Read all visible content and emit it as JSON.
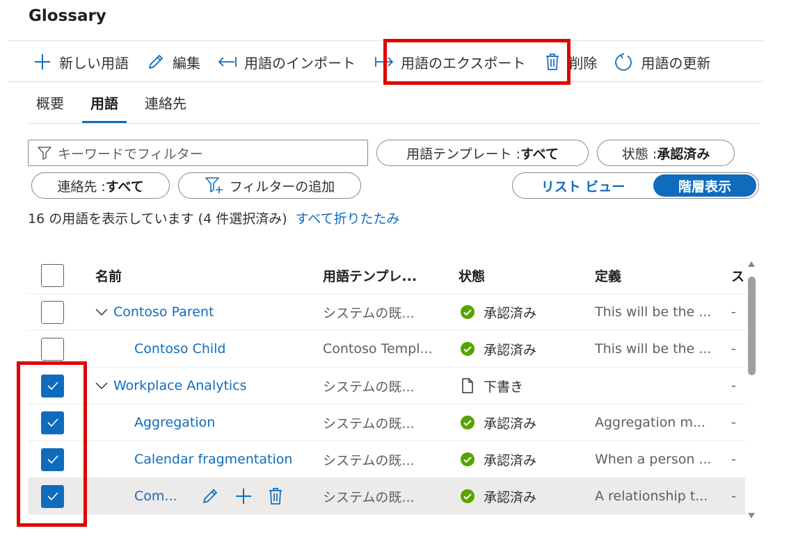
{
  "page": {
    "title": "Glossary"
  },
  "toolbar": {
    "new_term": "新しい用語",
    "edit": "編集",
    "import": "用語のインポート",
    "export": "用語のエクスポート",
    "delete": "削除",
    "refresh": "用語の更新"
  },
  "tabs": [
    "概要",
    "用語",
    "連絡先"
  ],
  "active_tab": "用語",
  "filters": {
    "search_placeholder": "キーワードでフィルター",
    "template_label": "用語テンプレート : ",
    "template_value": "すべて",
    "status_label": "状態 : ",
    "status_value": "承認済み",
    "contact_label": "連絡先 : ",
    "contact_value": "すべて",
    "add_filter": "フィルターの追加"
  },
  "view_toggle": {
    "list": "リスト ビュー",
    "hierarchy": "階層表示",
    "selected": "階層表示"
  },
  "summary": {
    "text": "16 の用語を表示しています (4 件選択済み)",
    "collapse_all": "すべて折りたたみ"
  },
  "table": {
    "columns": [
      "名前",
      "用語テンプレ...",
      "状態",
      "定義",
      "ス"
    ],
    "rows": [
      {
        "name": "Contoso Parent",
        "template": "システムの既...",
        "status": "承認済み",
        "definition": "This will be the ...",
        "extra": "-",
        "checked": false
      },
      {
        "name": "Contoso Child",
        "template": "Contoso Templ...",
        "status": "承認済み",
        "definition": "This will be the ...",
        "extra": "-",
        "checked": false
      },
      {
        "name": "Workplace Analytics",
        "template": "システムの既...",
        "status": "下書き",
        "definition": "",
        "extra": "-",
        "checked": true
      },
      {
        "name": "Aggregation",
        "template": "システムの既...",
        "status": "承認済み",
        "definition": "Aggregation m...",
        "extra": "-",
        "checked": true
      },
      {
        "name": "Calendar fragmentation",
        "template": "システムの既...",
        "status": "承認済み",
        "definition": "When a person ...",
        "extra": "-",
        "checked": true
      },
      {
        "name": "Com...",
        "template": "システムの既...",
        "status": "承認済み",
        "definition": "A relationship t...",
        "extra": "-",
        "checked": true
      }
    ]
  },
  "colors": {
    "accent": "#0f6cbd",
    "approved": "#57a300",
    "highlight": "#e00000",
    "row_hover": "#edebe9"
  },
  "icons": [
    "plus-icon",
    "pencil-icon",
    "import-arrow-icon",
    "export-arrow-icon",
    "trash-icon",
    "refresh-icon",
    "filter-icon",
    "filter-add-icon",
    "chevron-down-icon",
    "check-circle-icon",
    "document-icon",
    "checkmark-icon"
  ]
}
